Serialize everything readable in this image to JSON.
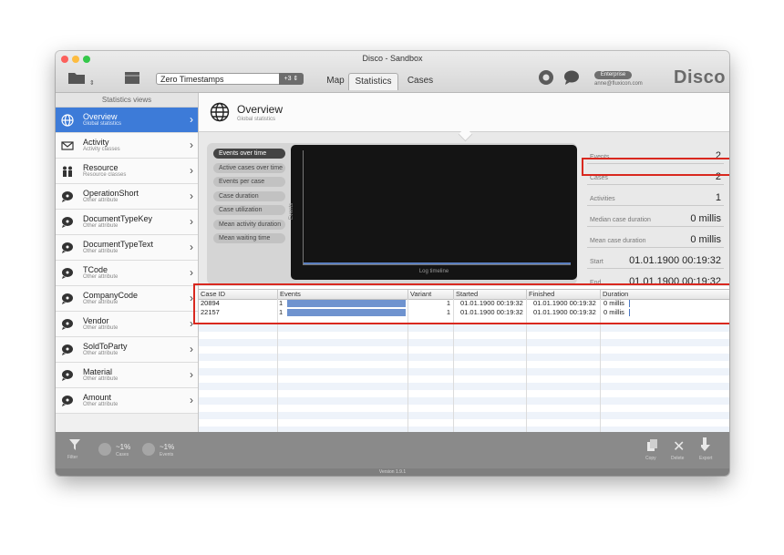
{
  "window": {
    "title": "Disco - Sandbox"
  },
  "toolbar": {
    "dataset": "Zero Timestamps",
    "dataset_badge": "+3",
    "tabs": [
      {
        "label": "Map"
      },
      {
        "label": "Statistics"
      },
      {
        "label": "Cases"
      }
    ],
    "active_tab": "Statistics",
    "license_badge": "Enterprise",
    "user_email": "anne@fluxicon.com",
    "brand": "Disco"
  },
  "sidebar": {
    "header": "Statistics views",
    "items": [
      {
        "title": "Overview",
        "subtitle": "Global statistics",
        "icon": "globe-icon"
      },
      {
        "title": "Activity",
        "subtitle": "Activity classes",
        "icon": "envelope-icon"
      },
      {
        "title": "Resource",
        "subtitle": "Resource classes",
        "icon": "people-icon"
      },
      {
        "title": "OperationShort",
        "subtitle": "Other attribute",
        "icon": "speech-bubble-icon"
      },
      {
        "title": "DocumentTypeKey",
        "subtitle": "Other attribute",
        "icon": "speech-bubble-icon"
      },
      {
        "title": "DocumentTypeText",
        "subtitle": "Other attribute",
        "icon": "speech-bubble-icon"
      },
      {
        "title": "TCode",
        "subtitle": "Other attribute",
        "icon": "speech-bubble-icon"
      },
      {
        "title": "CompanyCode",
        "subtitle": "Other attribute",
        "icon": "speech-bubble-icon"
      },
      {
        "title": "Vendor",
        "subtitle": "Other attribute",
        "icon": "speech-bubble-icon"
      },
      {
        "title": "SoldToParty",
        "subtitle": "Other attribute",
        "icon": "speech-bubble-icon"
      },
      {
        "title": "Material",
        "subtitle": "Other attribute",
        "icon": "speech-bubble-icon"
      },
      {
        "title": "Amount",
        "subtitle": "Other attribute",
        "icon": "speech-bubble-icon"
      }
    ]
  },
  "overview": {
    "title": "Overview",
    "subtitle": "Global statistics",
    "views": [
      {
        "label": "Events over time",
        "active": true
      },
      {
        "label": "Active cases over time"
      },
      {
        "label": "Events per case"
      },
      {
        "label": "Case duration"
      },
      {
        "label": "Case utilization"
      },
      {
        "label": "Mean activity duration"
      },
      {
        "label": "Mean waiting time"
      }
    ],
    "chart": {
      "ylabel": "Events",
      "xlabel": "Log timeline"
    },
    "stats": [
      {
        "label": "Events",
        "value": "2"
      },
      {
        "label": "Cases",
        "value": "2",
        "highlighted": true
      },
      {
        "label": "Activities",
        "value": "1"
      },
      {
        "label": "Median case duration",
        "value": "0 millis"
      },
      {
        "label": "Mean case duration",
        "value": "0 millis"
      },
      {
        "label": "Start",
        "value": "01.01.1900 00:19:32"
      },
      {
        "label": "End",
        "value": "01.01.1900 00:19:32"
      }
    ]
  },
  "cases_table": {
    "columns": [
      "Case ID",
      "Events",
      "Variant",
      "Started",
      "Finished",
      "Duration"
    ],
    "rows": [
      {
        "case_id": "20894",
        "events": "1",
        "variant": "1",
        "started": "01.01.1900 00:19:32",
        "finished": "01.01.1900 00:19:32",
        "duration": "0 millis"
      },
      {
        "case_id": "22157",
        "events": "1",
        "variant": "1",
        "started": "01.01.1900 00:19:32",
        "finished": "01.01.1900 00:19:32",
        "duration": "0 millis"
      }
    ]
  },
  "bottom": {
    "filter_label": "Filter",
    "cases_percent": "~1%",
    "cases_label": "Cases",
    "events_percent": "~1%",
    "events_label": "Events",
    "copy_label": "Copy",
    "delete_label": "Delete",
    "export_label": "Export",
    "version": "Version 1.9.1"
  },
  "colors": {
    "accent": "#3d7bd8",
    "highlight": "#d9281f",
    "bar": "#6f93cf"
  }
}
